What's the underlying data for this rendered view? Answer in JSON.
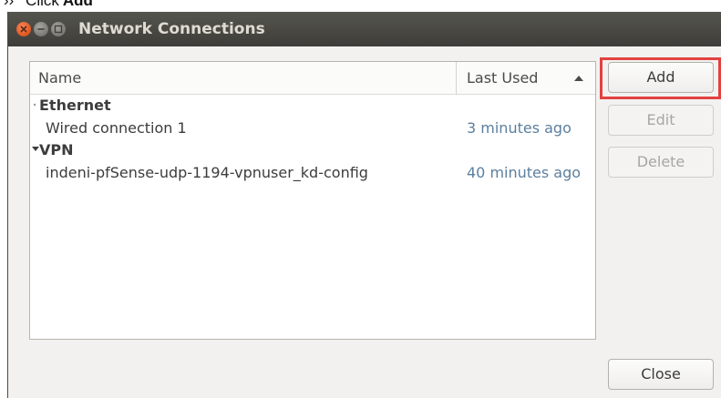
{
  "caption": {
    "step": "›› ",
    "verb": "Click",
    "target": "Add"
  },
  "window": {
    "title": "Network Connections"
  },
  "table": {
    "columns": {
      "name": "Name",
      "last_used": "Last Used"
    },
    "groups": [
      {
        "label": "Ethernet",
        "expanded": false,
        "items": [
          {
            "name": "Wired connection 1",
            "last_used": "3 minutes ago"
          }
        ]
      },
      {
        "label": "VPN",
        "expanded": true,
        "items": [
          {
            "name": "indeni-pfSense-udp-1194-vpnuser_kd-config",
            "last_used": "40 minutes ago"
          }
        ]
      }
    ]
  },
  "buttons": {
    "add": "Add",
    "edit": "Edit",
    "delete": "Delete",
    "close": "Close"
  },
  "colors": {
    "highlight": "#e2413f",
    "close_button": "#e0561f",
    "titlebar": "#3e3d39"
  }
}
